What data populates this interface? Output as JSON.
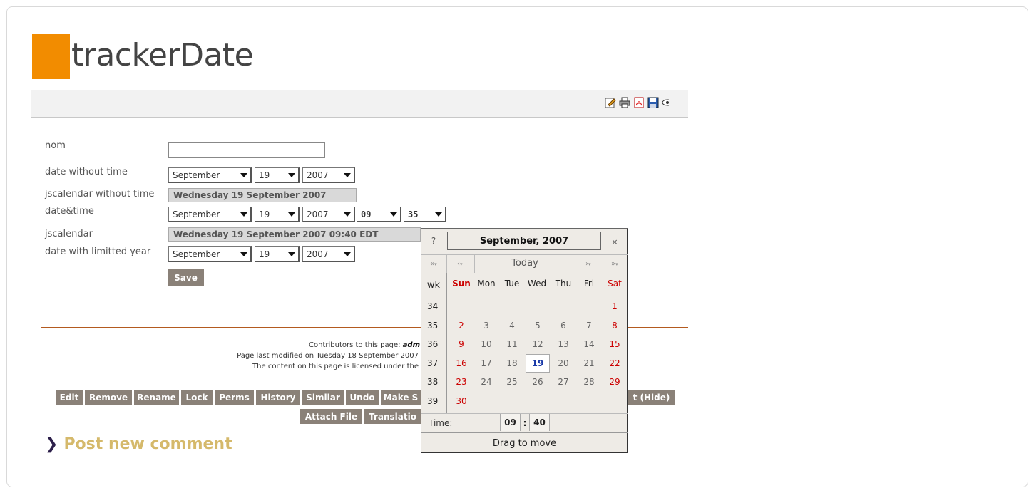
{
  "header": {
    "title": "trackerDate"
  },
  "toolbar": {
    "icons": [
      "edit-icon",
      "print-icon",
      "pdf-icon",
      "save-icon",
      "view-icon"
    ]
  },
  "form": {
    "nom_label": "nom",
    "nom_value": "",
    "date_wo_time_label": "date without time",
    "date_wo_time": {
      "month": "September",
      "day": "19",
      "year": "2007"
    },
    "jscal_wo_time_label": "jscalendar without time",
    "jscal_wo_time_value": "Wednesday 19 September 2007",
    "datetime_label": "date&time",
    "datetime": {
      "month": "September",
      "day": "19",
      "year": "2007",
      "hour": "09",
      "minute": "35"
    },
    "jscal_label": "jscalendar",
    "jscal_value": "Wednesday 19 September 2007 09:40 EDT",
    "date_limited_label": "date with limitted year",
    "date_limited": {
      "month": "September",
      "day": "19",
      "year": "2007"
    },
    "save_label": "Save"
  },
  "footer": {
    "contributors_prefix": "Contributors to this page:",
    "contributors_name": "adm",
    "last_modified": "Page last modified on Tuesday 18 September 2007",
    "license": "The content on this page is licensed under the"
  },
  "actions": {
    "row1": [
      "Edit",
      "Remove",
      "Rename",
      "Lock",
      "Perms",
      "History",
      "Similar",
      "Undo",
      "Make S",
      "t (Hide)"
    ],
    "row2": [
      "Attach File",
      "Translatio"
    ]
  },
  "comment": {
    "post_label": "Post new comment"
  },
  "calendar": {
    "help": "?",
    "title": "September, 2007",
    "close": "×",
    "prev_year": "«",
    "prev_month": "‹",
    "today": "Today",
    "next_month": "›",
    "next_year": "»",
    "wk_label": "wk",
    "day_headers": [
      "Sun",
      "Mon",
      "Tue",
      "Wed",
      "Thu",
      "Fri",
      "Sat"
    ],
    "weeks": [
      {
        "wk": "34",
        "days": [
          "",
          "",
          "",
          "",
          "",
          "",
          "1"
        ]
      },
      {
        "wk": "35",
        "days": [
          "2",
          "3",
          "4",
          "5",
          "6",
          "7",
          "8"
        ]
      },
      {
        "wk": "36",
        "days": [
          "9",
          "10",
          "11",
          "12",
          "13",
          "14",
          "15"
        ]
      },
      {
        "wk": "37",
        "days": [
          "16",
          "17",
          "18",
          "19",
          "20",
          "21",
          "22"
        ]
      },
      {
        "wk": "38",
        "days": [
          "23",
          "24",
          "25",
          "26",
          "27",
          "28",
          "29"
        ]
      },
      {
        "wk": "39",
        "days": [
          "30",
          "",
          "",
          "",
          "",
          "",
          ""
        ]
      }
    ],
    "selected_day": "19",
    "time_label": "Time:",
    "hour": "09",
    "time_sep": ":",
    "minute": "40",
    "drag_label": "Drag to move",
    "colors": {
      "weekend": "#cc0000",
      "selected": "#1a3aa8"
    }
  }
}
